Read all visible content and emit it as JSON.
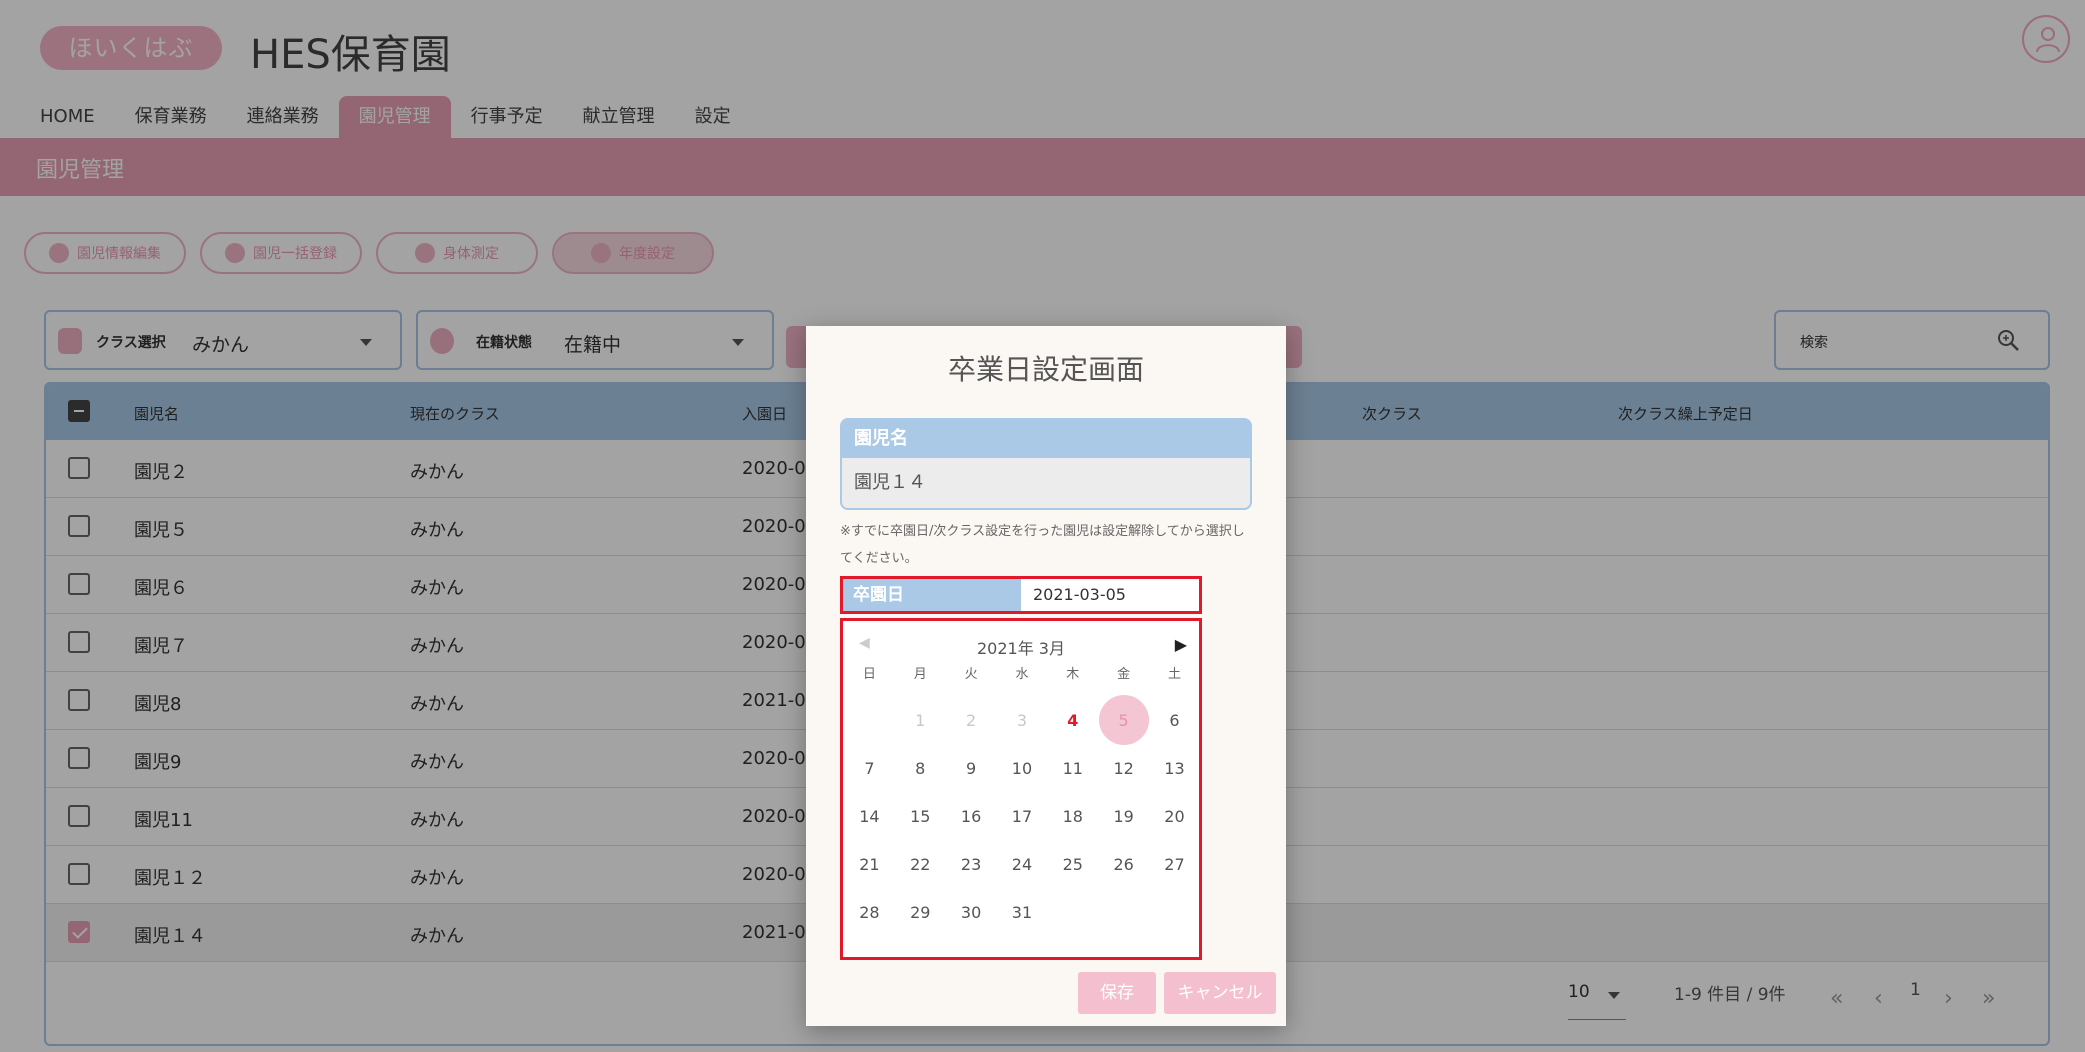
{
  "header": {
    "logo_text": "ほいくはぶ",
    "app_title": "HES保育園"
  },
  "nav": {
    "items": [
      {
        "label": "HOME"
      },
      {
        "label": "保育業務"
      },
      {
        "label": "連絡業務"
      },
      {
        "label": "園児管理"
      },
      {
        "label": "行事予定"
      },
      {
        "label": "献立管理"
      },
      {
        "label": "設定"
      }
    ],
    "active_index": 3
  },
  "band": {
    "title": "園児管理"
  },
  "subnav": {
    "items": [
      {
        "label": "園児情報編集"
      },
      {
        "label": "園児一括登録"
      },
      {
        "label": "身体測定"
      },
      {
        "label": "年度設定"
      }
    ]
  },
  "filters": {
    "class": {
      "label": "クラス選択",
      "value": "みかん"
    },
    "status": {
      "label": "在籍状態",
      "value": "在籍中"
    }
  },
  "search": {
    "label": "検索"
  },
  "table": {
    "columns": [
      "園児名",
      "現在のクラス",
      "入園日",
      "次クラス",
      "次クラス繰上予定日"
    ],
    "rows": [
      {
        "name": "園児２",
        "class": "みかん",
        "entry": "2020-0",
        "checked": false
      },
      {
        "name": "園児５",
        "class": "みかん",
        "entry": "2020-0",
        "checked": false
      },
      {
        "name": "園児６",
        "class": "みかん",
        "entry": "2020-0",
        "checked": false
      },
      {
        "name": "園児７",
        "class": "みかん",
        "entry": "2020-0",
        "checked": false
      },
      {
        "name": "園児8",
        "class": "みかん",
        "entry": "2021-0",
        "checked": false
      },
      {
        "name": "園児9",
        "class": "みかん",
        "entry": "2020-0",
        "checked": false
      },
      {
        "name": "園児11",
        "class": "みかん",
        "entry": "2020-0",
        "checked": false
      },
      {
        "name": "園児１２",
        "class": "みかん",
        "entry": "2020-0",
        "checked": false
      },
      {
        "name": "園児１４",
        "class": "みかん",
        "entry": "2021-0",
        "checked": true
      }
    ]
  },
  "pagination": {
    "page_size": "10",
    "range_text": "1-9 件目 / 9件",
    "current_page": "1"
  },
  "dialog": {
    "title": "卒業日設定画面",
    "name_label": "園児名",
    "name_value": "園児１４",
    "notice": "※すでに卒園日/次クラス設定を行った園児は設定解除してから選択してください。",
    "date_label": "卒園日",
    "date_value": "2021-03-05",
    "calendar": {
      "month_label": "2021年 3月",
      "weekdays": [
        "日",
        "月",
        "火",
        "水",
        "木",
        "金",
        "土"
      ],
      "weeks": [
        [
          "",
          "1",
          "2",
          "3",
          "4",
          "5",
          "6"
        ],
        [
          "7",
          "8",
          "9",
          "10",
          "11",
          "12",
          "13"
        ],
        [
          "14",
          "15",
          "16",
          "17",
          "18",
          "19",
          "20"
        ],
        [
          "21",
          "22",
          "23",
          "24",
          "25",
          "26",
          "27"
        ],
        [
          "28",
          "29",
          "30",
          "31",
          "",
          "",
          ""
        ]
      ],
      "past_days": [
        "1",
        "2",
        "3"
      ],
      "today": "4",
      "selected": "5"
    },
    "save_label": "保存",
    "cancel_label": "キャンセル"
  },
  "colors": {
    "brand_pink": "#e8a0b4",
    "header_blue": "#a9c9e6",
    "highlight_red": "#e1192b"
  }
}
